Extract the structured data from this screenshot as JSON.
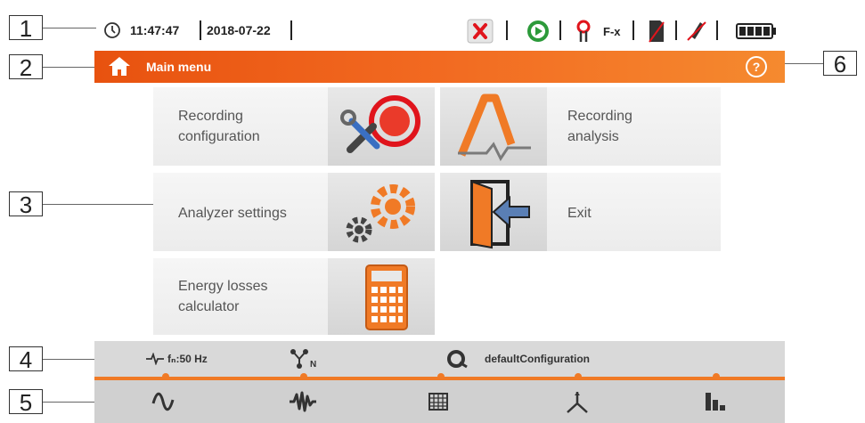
{
  "callouts": [
    "1",
    "2",
    "3",
    "4",
    "5",
    "6"
  ],
  "status": {
    "time": "11:47:47",
    "date": "2018-07-22",
    "clamp": "F-x"
  },
  "header": {
    "title": "Main menu"
  },
  "tiles": {
    "recording_config": [
      "Recording",
      "configuration"
    ],
    "recording_analysis": [
      "Recording",
      "analysis"
    ],
    "analyzer_settings": "Analyzer settings",
    "exit": "Exit",
    "energy_losses": [
      "Energy losses",
      "calculator"
    ]
  },
  "infobar": {
    "frequency": "fₙ:50 Hz",
    "configuration": "defaultConfiguration"
  },
  "colors": {
    "accent": "#f26a21",
    "bar": "#d9d9d9"
  }
}
